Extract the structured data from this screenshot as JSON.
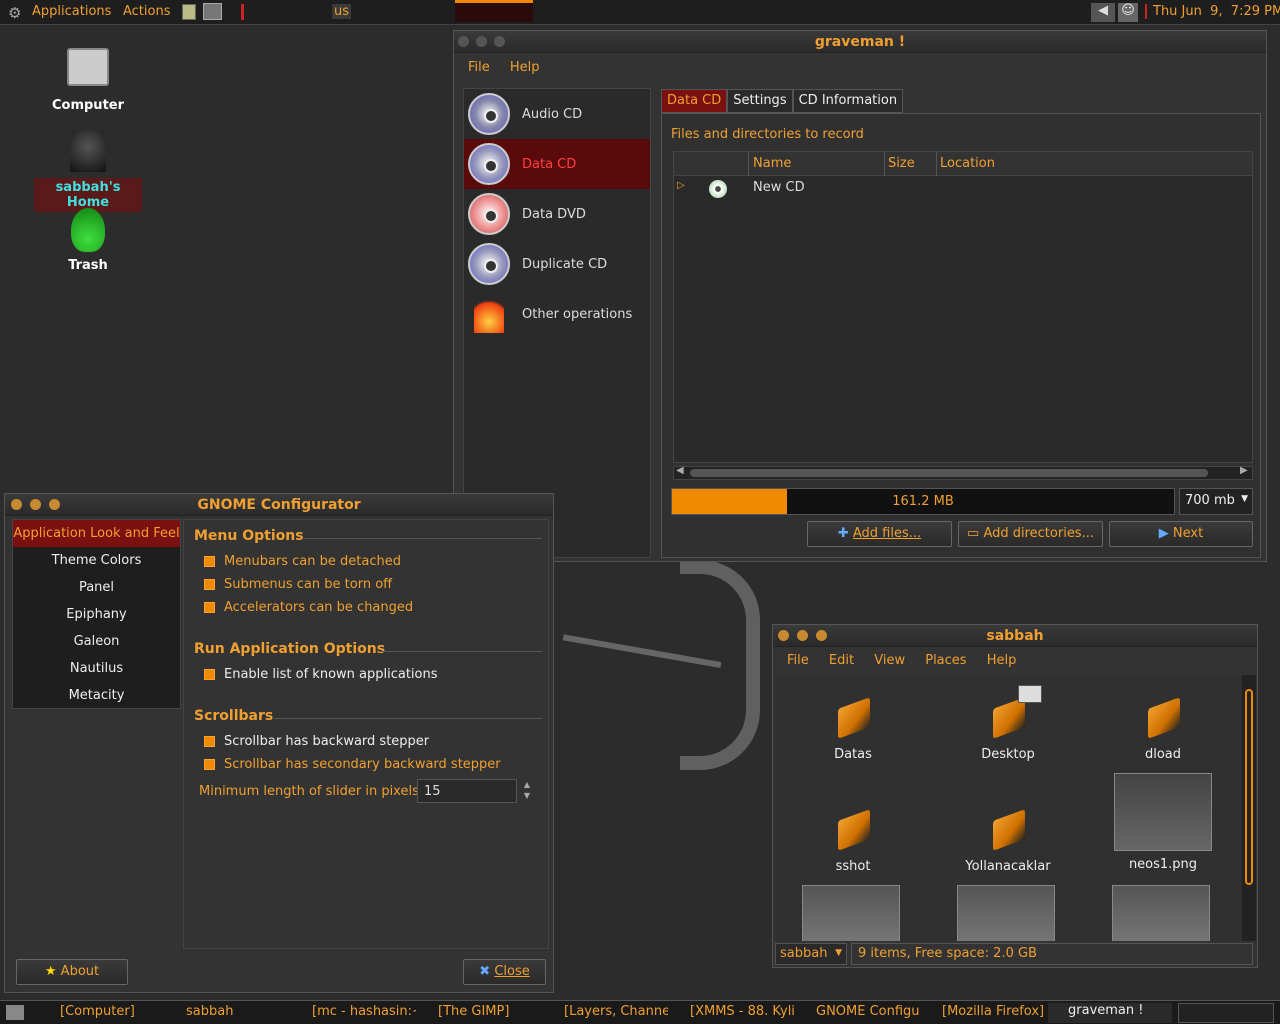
{
  "top_panel": {
    "menus": [
      "Applications",
      "Actions"
    ],
    "keyboard": "us",
    "clock": "Thu Jun  9,  7:29 PM"
  },
  "desktop_icons": [
    {
      "label": "Computer",
      "icon": "computer-icon"
    },
    {
      "label": "sabbah's Home",
      "icon": "home-icon"
    },
    {
      "label": "Trash",
      "icon": "trash-icon"
    }
  ],
  "graveman": {
    "title": "graveman !",
    "menu": [
      "File",
      "Help"
    ],
    "sidebar": [
      {
        "label": "Audio CD",
        "selected": false
      },
      {
        "label": "Data CD",
        "selected": true
      },
      {
        "label": "Data DVD",
        "selected": false
      },
      {
        "label": "Duplicate CD",
        "selected": false
      },
      {
        "label": "Other operations",
        "selected": false
      }
    ],
    "tabs": [
      "Data CD",
      "Settings",
      "CD Information"
    ],
    "section": "Files and directories to record",
    "columns": [
      "Name",
      "Size",
      "Location"
    ],
    "rows": [
      {
        "name": "New CD",
        "size": "",
        "location": ""
      }
    ],
    "usage": {
      "text": "161.2 MB",
      "fraction": 0.23
    },
    "capacity": "700 mb",
    "buttons": {
      "add_files": "Add files...",
      "add_dirs": "Add directories...",
      "next": "Next"
    }
  },
  "configurator": {
    "title": "GNOME Configurator",
    "nav": [
      "Application Look and Feel",
      "Theme Colors",
      "Panel",
      "Epiphany",
      "Galeon",
      "Nautilus",
      "Metacity"
    ],
    "menu_options_title": "Menu Options",
    "menu_options": [
      "Menubars can be detached",
      "Submenus can be torn off",
      "Accelerators can be changed"
    ],
    "run_title": "Run Application Options",
    "run_options": [
      "Enable list of known applications"
    ],
    "scroll_title": "Scrollbars",
    "scroll_options": [
      "Scrollbar has backward stepper",
      "Scrollbar has secondary backward stepper"
    ],
    "slider_label": "Minimum length of slider in pixels",
    "slider_value": "15",
    "about": "About",
    "close": "Close"
  },
  "nautilus": {
    "title": "sabbah",
    "menu": [
      "File",
      "Edit",
      "View",
      "Places",
      "Help"
    ],
    "items": [
      "Datas",
      "Desktop",
      "dload",
      "sshot",
      "Yollanacaklar",
      "neos1.png"
    ],
    "location": "sabbah",
    "status": "9 items, Free space: 2.0 GB"
  },
  "taskbar": [
    "[Computer]",
    "sabbah",
    "[mc - hashasin:~",
    "[The GIMP]",
    "[Layers, Channe",
    "[XMMS - 88. Kyli",
    "GNOME Configur",
    "[Mozilla Firefox]",
    "graveman !"
  ],
  "colors": {
    "accent": "#f0a030",
    "selected": "#7a1010"
  }
}
